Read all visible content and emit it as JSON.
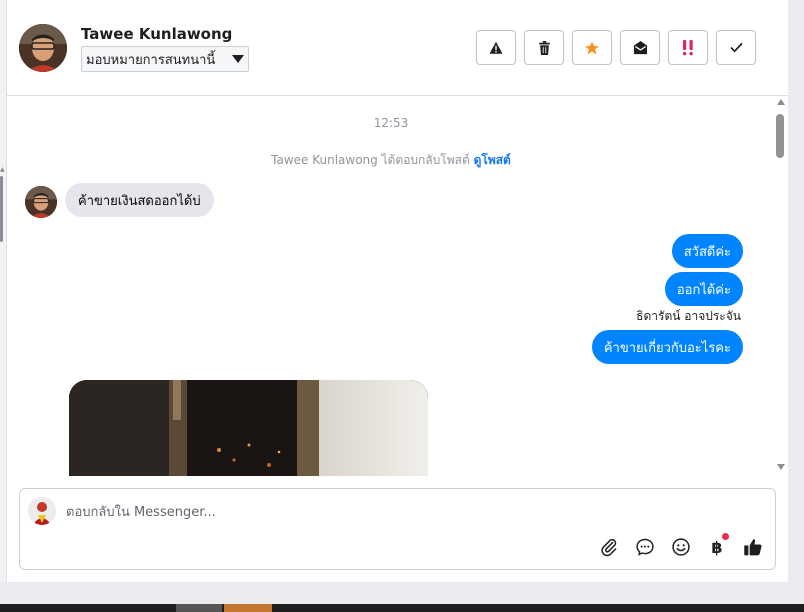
{
  "header": {
    "contact_name": "Tawee Kunlawong",
    "assign_label": "มอบหมายการสนทนานี้"
  },
  "toolbar": {
    "buttons": [
      {
        "name": "report-spam",
        "icon": "warning-triangle-icon"
      },
      {
        "name": "delete",
        "icon": "trash-icon"
      },
      {
        "name": "star",
        "icon": "star-icon",
        "color": "#f7931e"
      },
      {
        "name": "mark-unread",
        "icon": "envelope-open-icon"
      },
      {
        "name": "follow-up",
        "icon": "double-exclamation-icon",
        "color": "#e0245e"
      },
      {
        "name": "mark-done",
        "icon": "check-icon"
      }
    ]
  },
  "chat": {
    "timestamp": "12:53",
    "reply_note_text": "Tawee Kunlawong ได้ตอบกลับโพสต์ ",
    "reply_note_link": "ดูโพสต์",
    "incoming": [
      {
        "text": "ค้าขายเงินสดออกได้บ่"
      }
    ],
    "outgoing": [
      {
        "text": "สวัสดีค่ะ"
      },
      {
        "text": "ออกได้ค่ะ"
      },
      {
        "text": "ค้าขายเกี่ยวกับอะไรคะ"
      }
    ],
    "sender_label": "ธิดารัตน์ อาจประจัน"
  },
  "composer": {
    "placeholder": "ตอบกลับใน Messenger..."
  },
  "colors": {
    "outgoing_bubble": "#0084ff",
    "incoming_bubble": "#e4e6eb",
    "link": "#1877f2"
  }
}
